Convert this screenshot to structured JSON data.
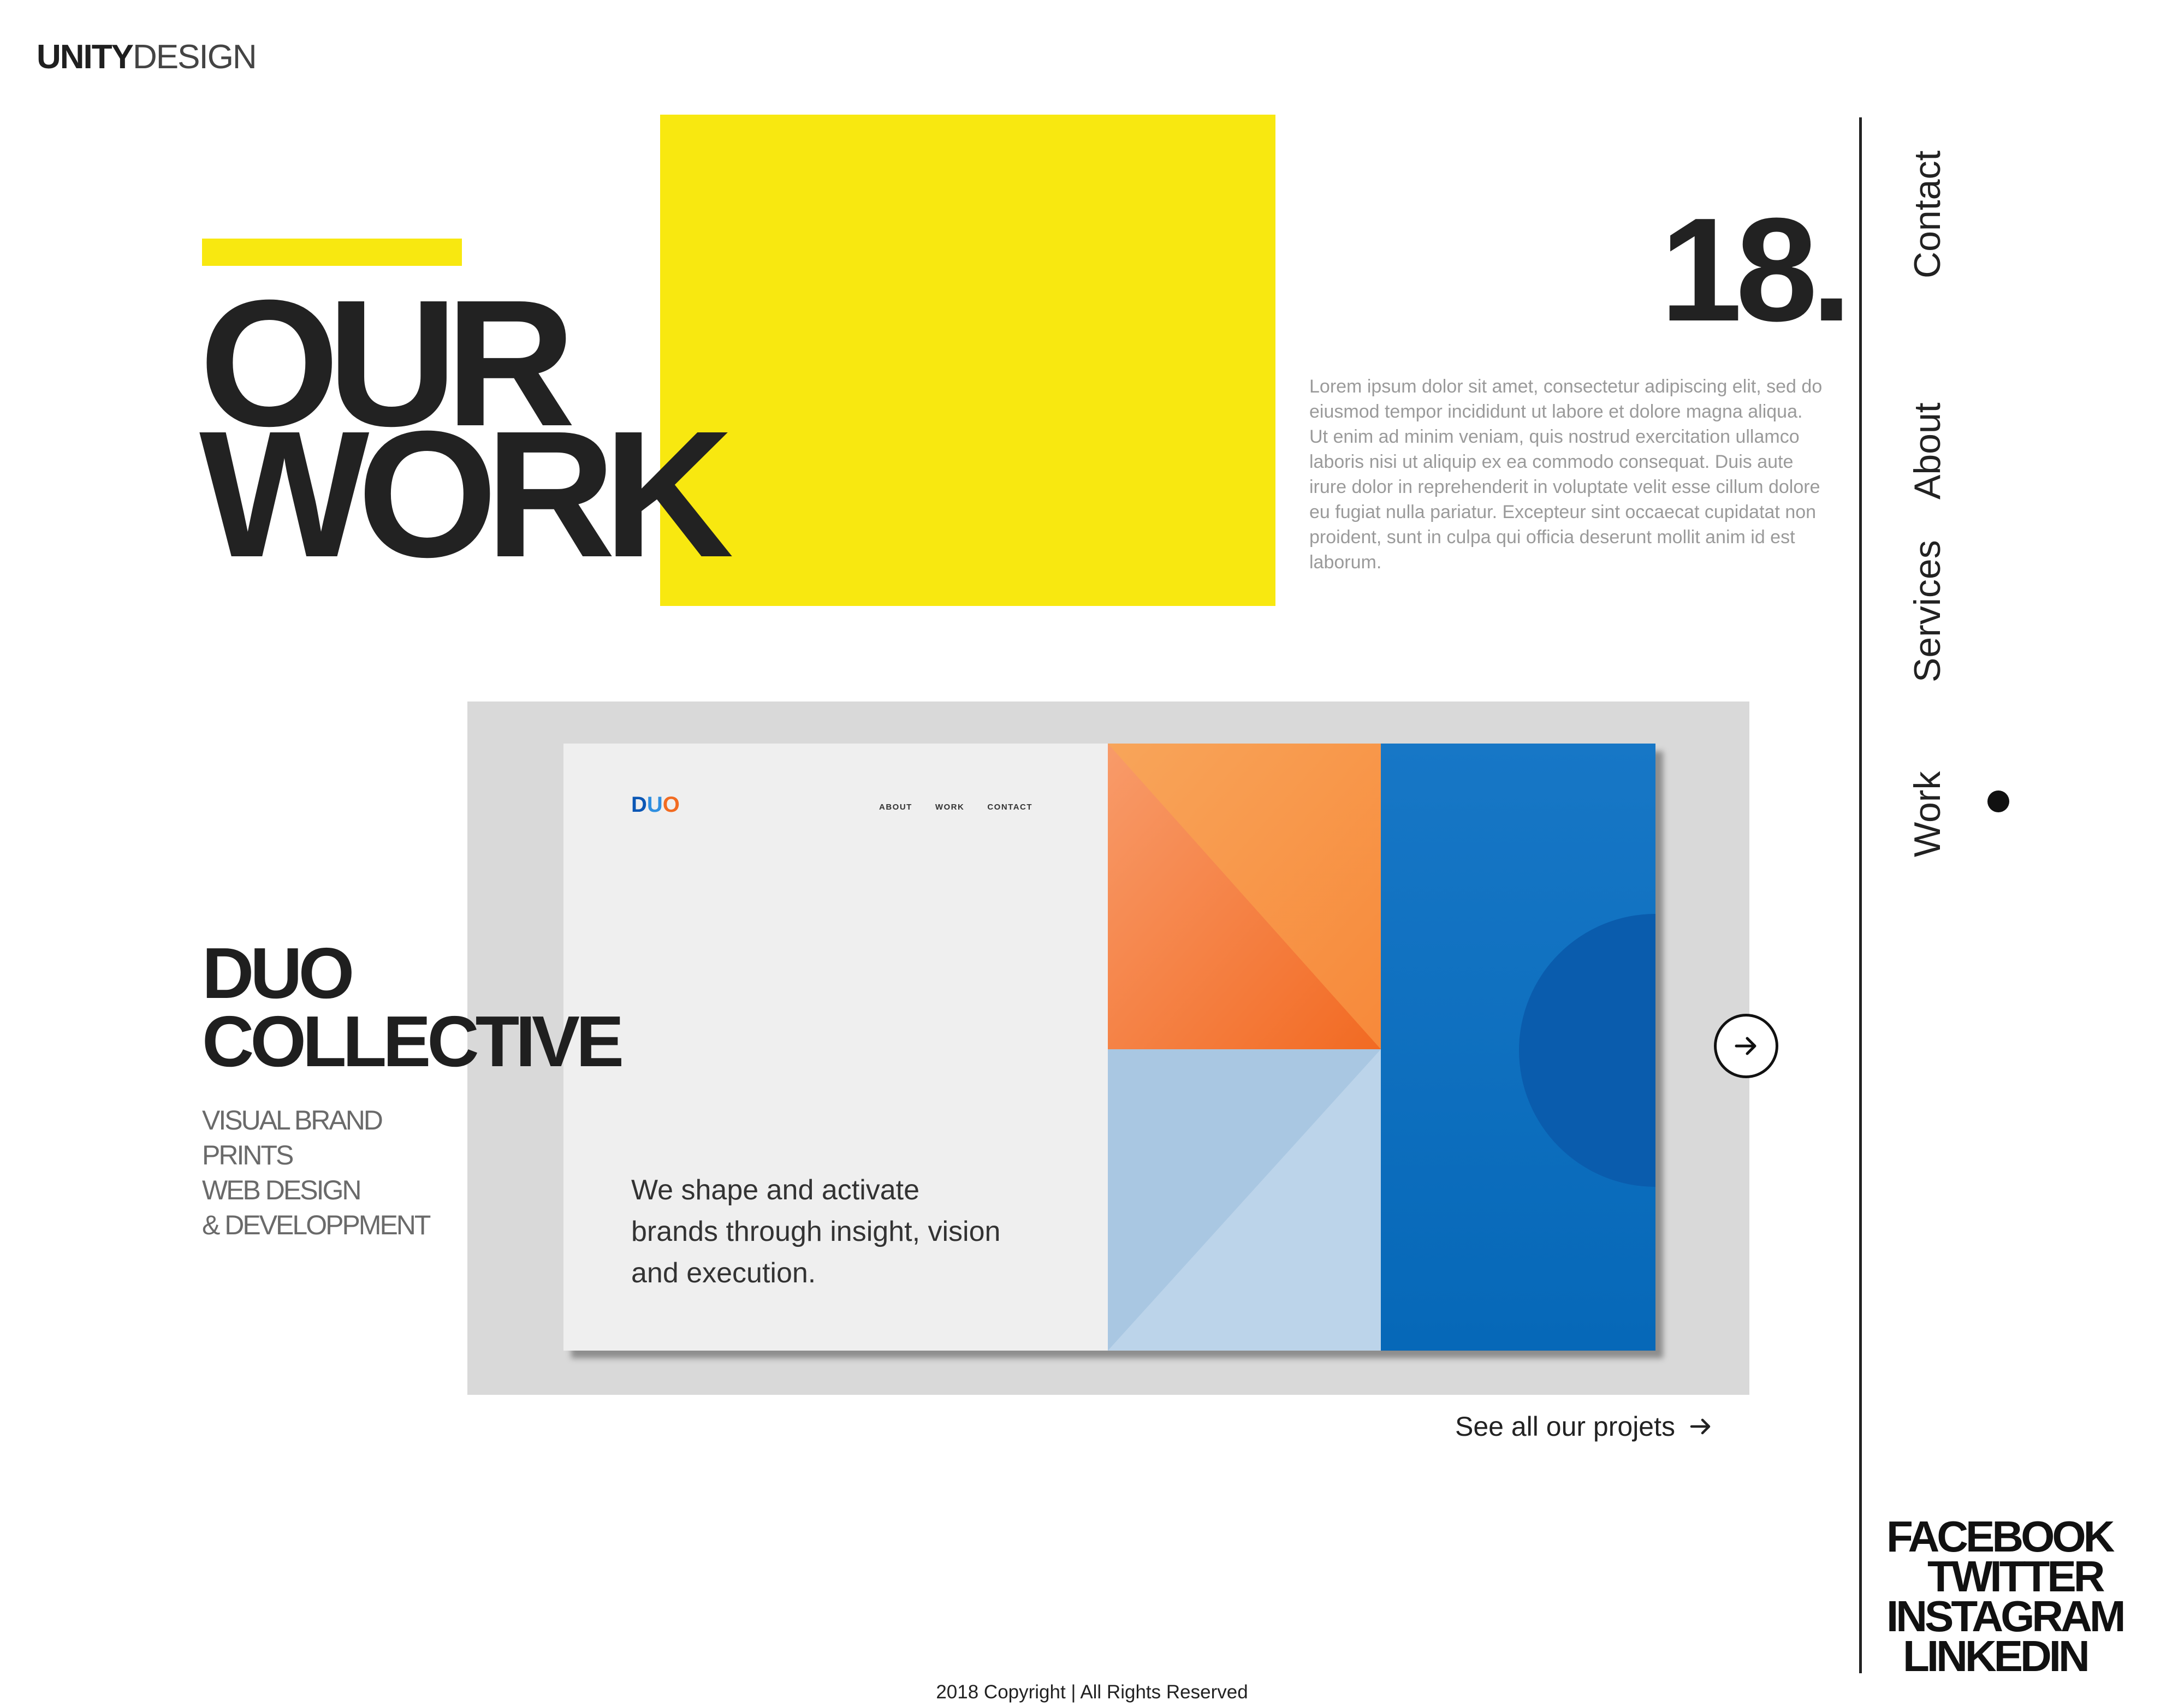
{
  "brand": {
    "strong": "UNITY",
    "light": "DESIGN"
  },
  "hero": {
    "title_line1": "OUR",
    "title_line2": "WORK",
    "number": "18.",
    "description": "Lorem ipsum dolor sit amet, consectetur adipiscing elit, sed do eiusmod tempor incididunt ut labore et dolore magna aliqua. Ut enim ad minim veniam, quis nostrud exercitation ullamco laboris nisi ut aliquip ex ea commodo consequat. Duis aute irure dolor in reprehenderit in voluptate velit esse cillum dolore eu fugiat nulla pariatur. Excepteur sint occaecat cupidatat non proident, sunt in culpa qui officia deserunt mollit anim id est laborum."
  },
  "nav": {
    "items": [
      {
        "label": "Contact"
      },
      {
        "label": "About"
      },
      {
        "label": "Services"
      },
      {
        "label": "Work"
      }
    ],
    "active": "Work"
  },
  "project": {
    "title_line1": "DUO",
    "title_line2": "COLLECTIVE",
    "tags": [
      "VISUAL BRAND",
      "PRINTS",
      "WEB DESIGN",
      "& DEVELOPPMENT"
    ],
    "next_icon": "arrow-right-icon"
  },
  "mockup": {
    "logo": {
      "d": "D",
      "u": "U",
      "o": "O"
    },
    "nav": [
      "ABOUT",
      "WORK",
      "CONTACT"
    ],
    "tagline": "We shape and activate brands through insight, vision and execution."
  },
  "see_all": {
    "label": "See all our projets",
    "icon": "arrow-right-icon"
  },
  "social": [
    "FACEBOOK",
    "TWITTER",
    "INSTAGRAM",
    "LINKEDIN"
  ],
  "footer": {
    "copyright": "2018 Copyright | All Rights Reserved"
  },
  "colors": {
    "accent_yellow": "#f8e810",
    "text_dark": "#222222",
    "frame_gray": "#d9d9d9",
    "mock_orange": "#f7893a",
    "mock_blue": "#0b6ebd",
    "mock_light_blue": "#a9c7e2"
  }
}
